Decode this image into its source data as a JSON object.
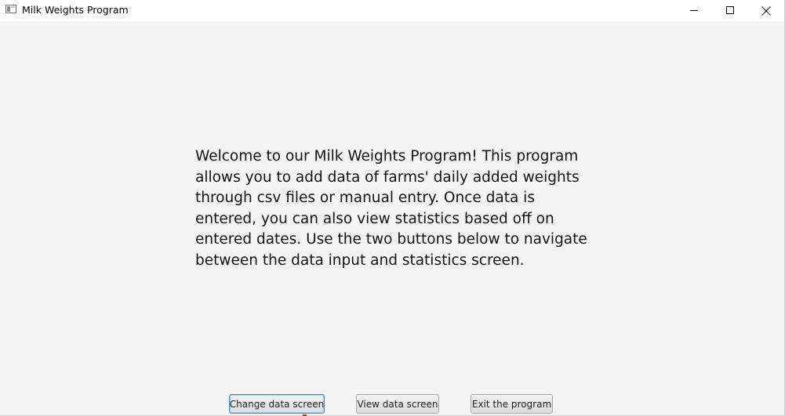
{
  "window": {
    "title": "Milk Weights Program",
    "icons": {
      "app": "app-window-icon",
      "minimize": "minimize-icon",
      "maximize": "maximize-icon",
      "close": "close-icon"
    }
  },
  "main": {
    "welcome_text": "Welcome to our Milk Weights Program! This program allows you to add data of farms' daily added weights through csv files or manual entry. Once data is entered, you can also view statistics based off on entered dates. Use the two buttons below to navigate between the data input and statistics screen."
  },
  "buttons": {
    "change_data": "Change data screen",
    "view_data": "View data screen",
    "exit": "Exit the program"
  },
  "colors": {
    "background": "#f4f4f4",
    "titlebar": "#ffffff",
    "focus_border": "#3c8fd6"
  }
}
